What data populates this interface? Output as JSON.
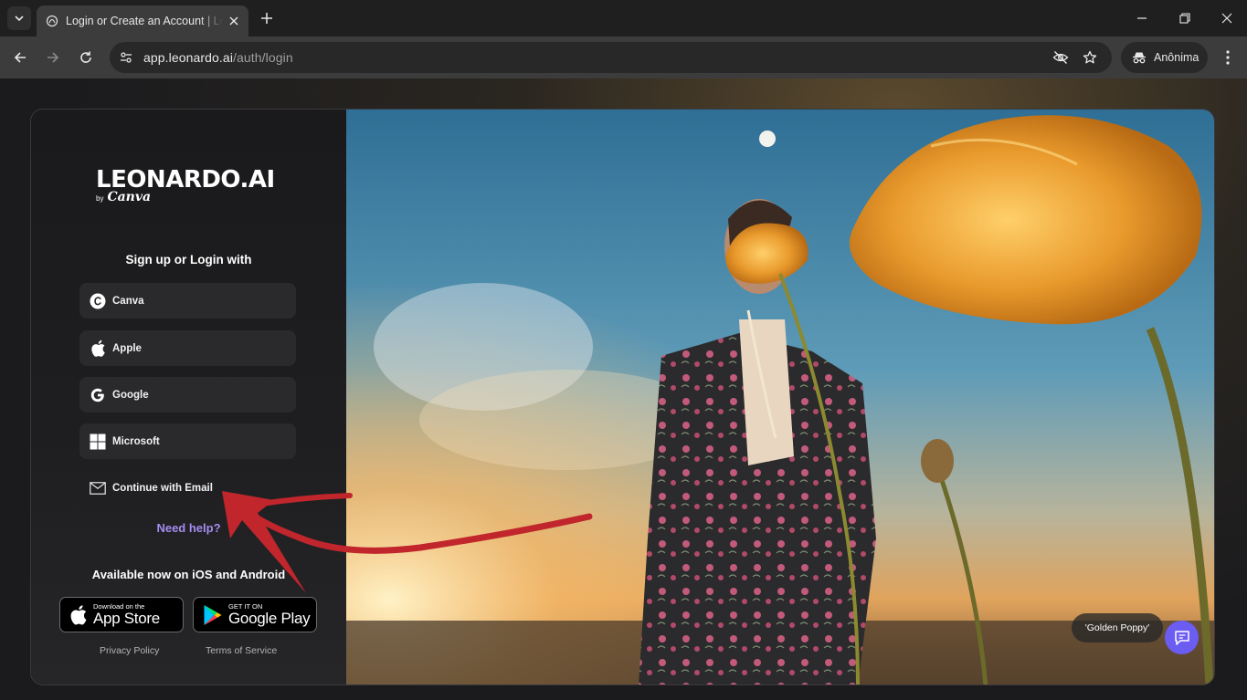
{
  "browser": {
    "tab_title": "Login or Create an Account | Leonardo.Ai",
    "url_host": "app.leonardo.ai",
    "url_path": "/auth/login",
    "profile_label": "Anônima",
    "accent": "#3c3c3c"
  },
  "panel": {
    "logo_main": "LEONARDO.AI",
    "logo_by": "by",
    "logo_brand": "Canva",
    "signup_title": "Sign up or Login with",
    "providers": [
      {
        "label": "Canva",
        "icon": "canva-icon"
      },
      {
        "label": "Apple",
        "icon": "apple-icon"
      },
      {
        "label": "Google",
        "icon": "google-icon"
      },
      {
        "label": "Microsoft",
        "icon": "microsoft-icon"
      },
      {
        "label": "Continue with Email",
        "icon": "mail-icon"
      }
    ],
    "need_help": "Need help?",
    "available": "Available now on iOS and Android",
    "app_store": {
      "small": "Download on the",
      "big": "App Store"
    },
    "google_play": {
      "small": "GET IT ON",
      "big": "Google Play"
    },
    "privacy": "Privacy Policy",
    "terms": "Terms of Service",
    "link_color": "#a58cf0"
  },
  "hero": {
    "caption": "'Golden Poppy'",
    "chat_color": "#6b5cf2"
  },
  "annotation": {
    "arrow_color": "#c0262c"
  }
}
